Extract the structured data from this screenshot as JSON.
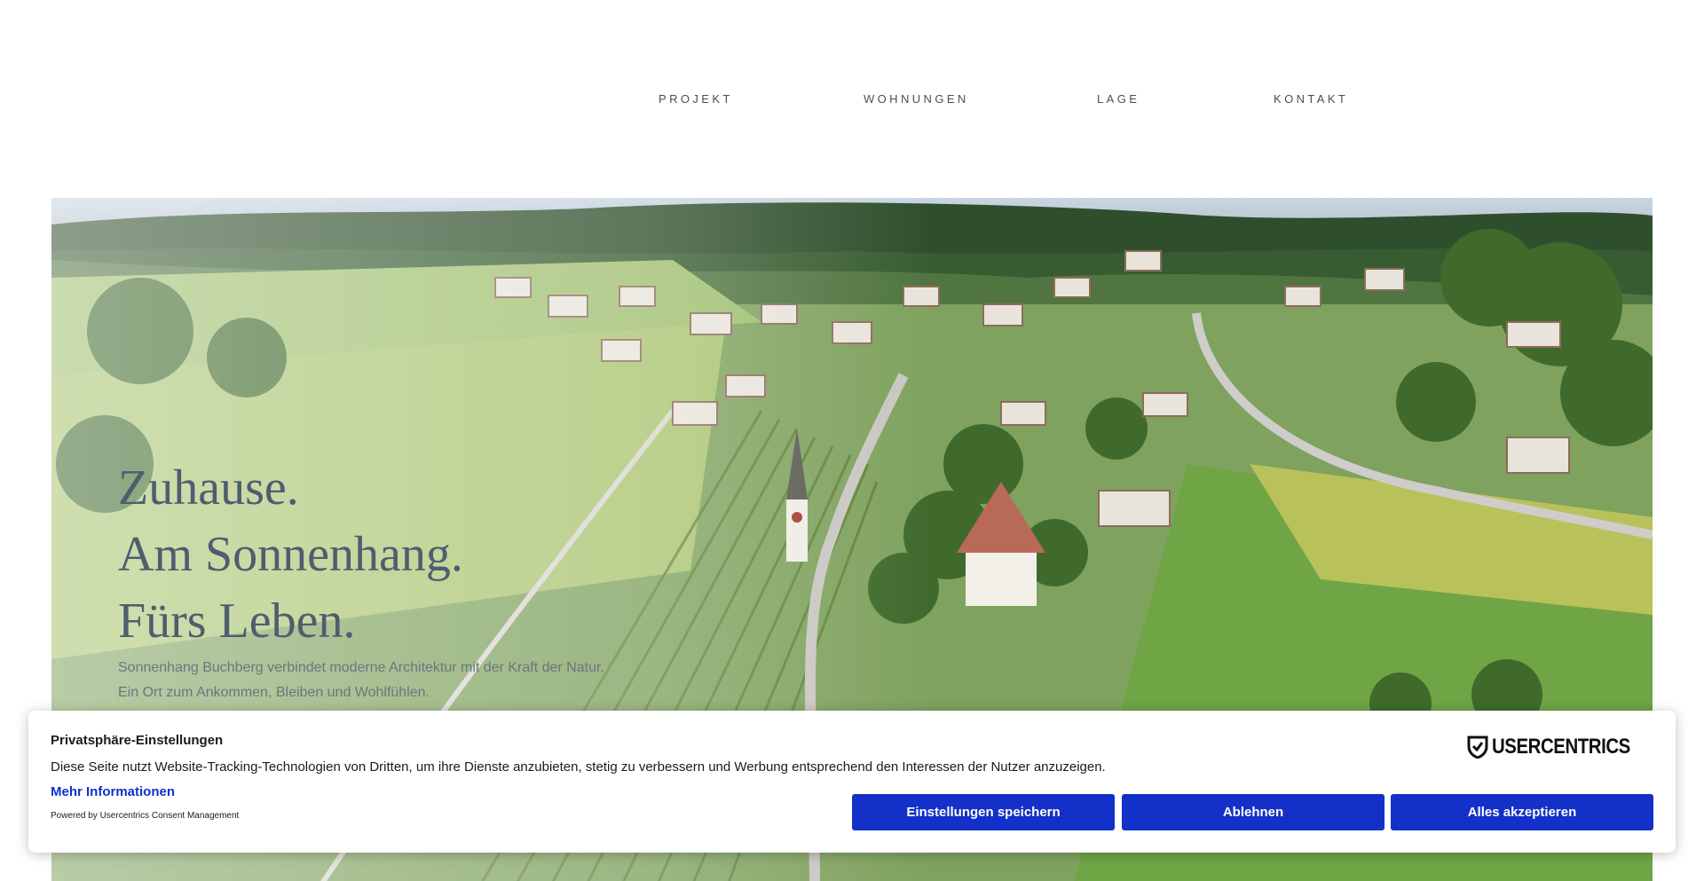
{
  "nav": {
    "items": [
      {
        "label": "PROJEKT"
      },
      {
        "label": "WOHNUNGEN"
      },
      {
        "label": "LAGE"
      },
      {
        "label": "KONTAKT"
      }
    ]
  },
  "hero": {
    "headline": [
      "Zuhause.",
      "Am Sonnenhang.",
      "Fürs Leben."
    ],
    "sub": [
      "Sonnenhang Buchberg verbindet moderne Architektur mit der Kraft der Natur.",
      "Ein Ort zum Ankommen, Bleiben und Wohlfühlen."
    ]
  },
  "consent": {
    "title": "Privatsphäre-Einstellungen",
    "description": "Diese Seite nutzt Website-Tracking-Technologien von Dritten, um ihre Dienste anzubieten, stetig zu verbessern und Werbung entsprechend den Interessen der Nutzer anzuzeigen.",
    "more_link": "Mehr Informationen",
    "powered_by": "Powered by Usercentrics Consent Management",
    "logo_text": "USERCENTRICS",
    "buttons": {
      "save": "Einstellungen speichern",
      "deny": "Ablehnen",
      "accept": "Alles akzeptieren"
    },
    "accent_color": "#1330c9"
  }
}
